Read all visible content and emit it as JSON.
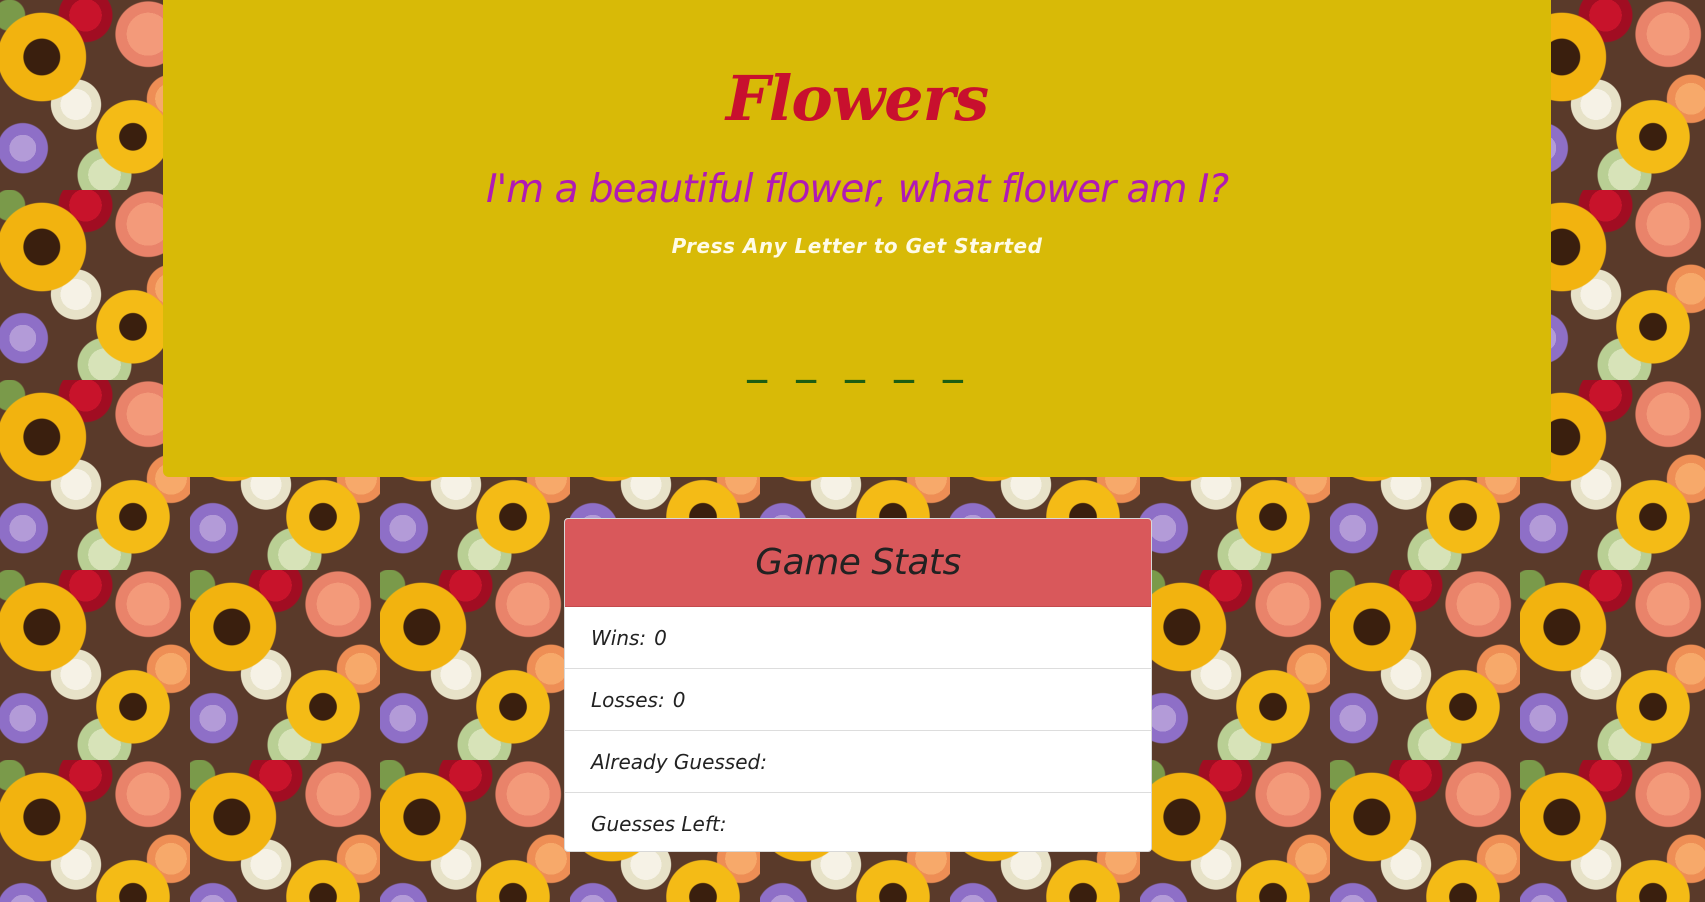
{
  "header": {
    "title": "Flowers",
    "subtitle": "I'm a beautiful flower, what flower am I?",
    "instruction": "Press Any Letter to Get Started",
    "word_display": "_ _ _ _ _"
  },
  "stats": {
    "title": "Game Stats",
    "wins_label": "Wins:",
    "wins_value": "0",
    "losses_label": "Losses:",
    "losses_value": "0",
    "guessed_label": "Already Guessed:",
    "guessed_value": "",
    "left_label": "Guesses Left:",
    "left_value": ""
  },
  "colors": {
    "banner": "#d8ba07",
    "title": "#c8102e",
    "subtitle": "#b01ab5",
    "word": "#1d5e12",
    "card_header": "#d9585b"
  },
  "background": {
    "image": "sunflower-and-rose-bouquet-pattern"
  }
}
